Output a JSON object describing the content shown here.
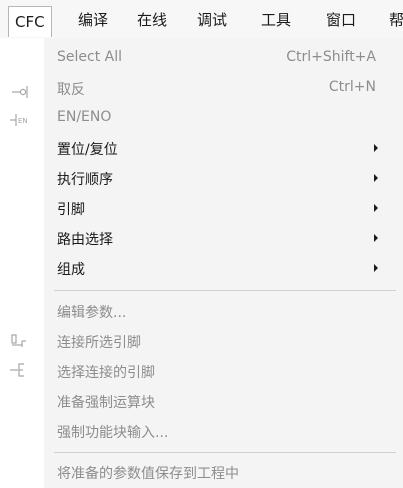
{
  "menubar": {
    "items": [
      {
        "label": "CFC",
        "active": true
      },
      {
        "label": "编译"
      },
      {
        "label": "在线"
      },
      {
        "label": "调试"
      },
      {
        "label": "工具"
      },
      {
        "label": "窗口"
      },
      {
        "label": "帮"
      }
    ]
  },
  "dropdown": {
    "items": [
      {
        "label": "Select All",
        "shortcut": "Ctrl+Shift+A",
        "enabled": false
      },
      {
        "label": "取反",
        "shortcut": "Ctrl+N",
        "enabled": false,
        "icon": "negate-icon"
      },
      {
        "label": "EN/ENO",
        "enabled": false,
        "icon": "en-eno-icon"
      },
      {
        "label": "置位/复位",
        "enabled": true,
        "submenu": true
      },
      {
        "label": "执行顺序",
        "enabled": true,
        "submenu": true
      },
      {
        "label": "引脚",
        "enabled": true,
        "submenu": true
      },
      {
        "label": "路由选择",
        "enabled": true,
        "submenu": true
      },
      {
        "label": "组成",
        "enabled": true,
        "submenu": true
      },
      {
        "label": "编辑参数...",
        "enabled": false
      },
      {
        "label": "连接所选引脚",
        "enabled": false,
        "icon": "connect-pins-icon"
      },
      {
        "label": "选择连接的引脚",
        "enabled": false,
        "icon": "select-connected-pins-icon"
      },
      {
        "label": "准备强制运算块",
        "enabled": false
      },
      {
        "label": "强制功能块输入...",
        "enabled": false
      },
      {
        "label": "将准备的参数值保存到工程中",
        "enabled": false
      }
    ]
  },
  "colors": {
    "menu_background": "#f4f4f4",
    "enabled_text": "#1a1a1a",
    "disabled_text": "#8d8d8d",
    "separator": "#d0d0d0"
  }
}
